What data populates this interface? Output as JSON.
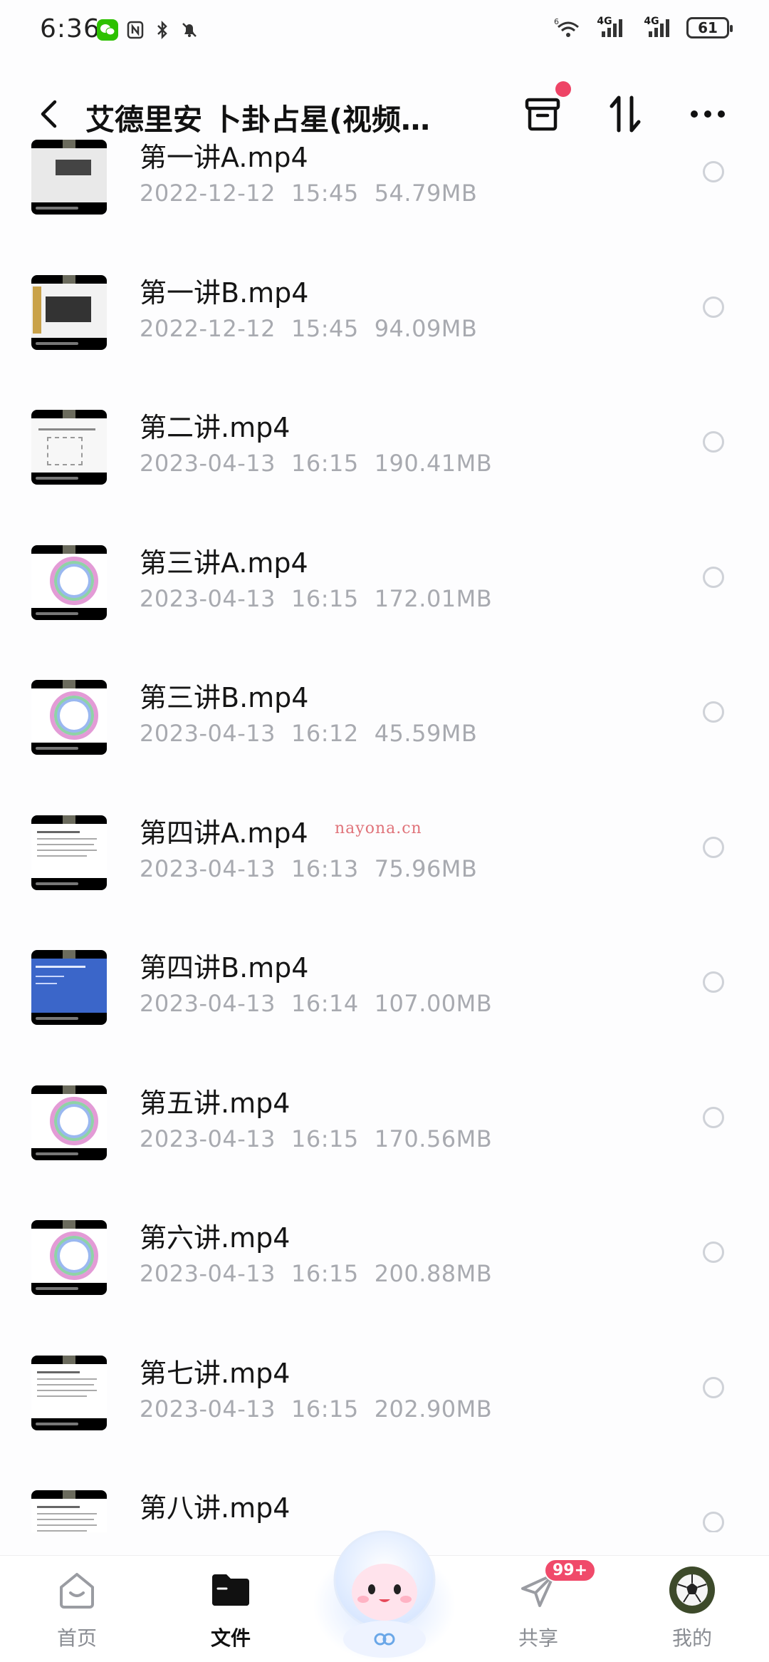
{
  "status_bar": {
    "time": "6:36",
    "network_1": "4G",
    "network_2": "4G",
    "battery": "61",
    "wifi_sup": "6"
  },
  "header": {
    "title": "艾德里安 卜卦占星(视频…",
    "has_notification_dot": true
  },
  "files": [
    {
      "name": "第一讲A.mp4",
      "date": "2022-12-12",
      "time": "15:45",
      "size": "54.79MB",
      "thumb": "grey"
    },
    {
      "name": "第一讲B.mp4",
      "date": "2022-12-12",
      "time": "15:45",
      "size": "94.09MB",
      "thumb": "dark-slide"
    },
    {
      "name": "第二讲.mp4",
      "date": "2023-04-13",
      "time": "16:15",
      "size": "190.41MB",
      "thumb": "diagram"
    },
    {
      "name": "第三讲A.mp4",
      "date": "2023-04-13",
      "time": "16:15",
      "size": "172.01MB",
      "thumb": "wheel"
    },
    {
      "name": "第三讲B.mp4",
      "date": "2023-04-13",
      "time": "16:12",
      "size": "45.59MB",
      "thumb": "wheel"
    },
    {
      "name": "第四讲A.mp4",
      "date": "2023-04-13",
      "time": "16:13",
      "size": "75.96MB",
      "thumb": "text"
    },
    {
      "name": "第四讲B.mp4",
      "date": "2023-04-13",
      "time": "16:14",
      "size": "107.00MB",
      "thumb": "blue"
    },
    {
      "name": "第五讲.mp4",
      "date": "2023-04-13",
      "time": "16:15",
      "size": "170.56MB",
      "thumb": "wheel"
    },
    {
      "name": "第六讲.mp4",
      "date": "2023-04-13",
      "time": "16:15",
      "size": "200.88MB",
      "thumb": "wheel"
    },
    {
      "name": "第七讲.mp4",
      "date": "2023-04-13",
      "time": "16:15",
      "size": "202.90MB",
      "thumb": "text"
    },
    {
      "name": "第八讲.mp4",
      "date": "",
      "time": "",
      "size": "",
      "thumb": "text"
    }
  ],
  "watermark": "nayona.cn",
  "bottom_nav": {
    "home": "首页",
    "files": "文件",
    "share": "共享",
    "me": "我的",
    "share_badge": "99+"
  },
  "colors": {
    "accent_red": "#ee4466",
    "meta_gray": "#a8aab0",
    "active_label": "#111111"
  }
}
